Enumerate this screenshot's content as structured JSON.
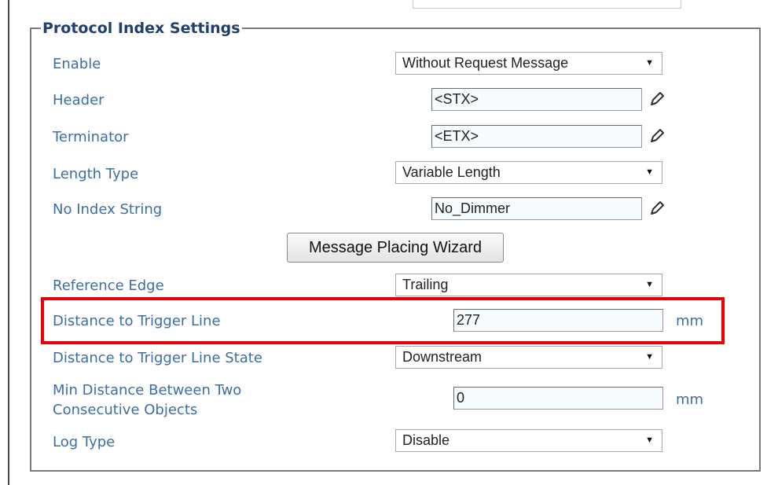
{
  "panel": {
    "title": "Protocol Index Settings"
  },
  "fields": {
    "enable": {
      "label": "Enable",
      "value": "Without Request Message"
    },
    "header": {
      "label": "Header",
      "value": "<STX>"
    },
    "terminator": {
      "label": "Terminator",
      "value": "<ETX>"
    },
    "length_type": {
      "label": "Length Type",
      "value": "Variable Length"
    },
    "no_index_string": {
      "label": "No Index String",
      "value": "No_Dimmer"
    },
    "reference_edge": {
      "label": "Reference Edge",
      "value": "Trailing"
    },
    "distance_to_trigger_line": {
      "label": "Distance to Trigger Line",
      "value": "277",
      "unit": "mm"
    },
    "distance_to_trigger_line_state": {
      "label": "Distance to Trigger Line State",
      "value": "Downstream"
    },
    "min_distance": {
      "label_line1": "Min Distance Between Two",
      "label_line2": "Consecutive Objects",
      "value": "0",
      "unit": "mm"
    },
    "log_type": {
      "label": "Log Type",
      "value": "Disable"
    }
  },
  "buttons": {
    "wizard": "Message Placing Wizard"
  },
  "icons": {
    "edit": "pencil-icon",
    "dropdown": "chevron-down-icon"
  },
  "colors": {
    "label": "#3c6ea5",
    "title": "#1f3f73",
    "highlight": "#e8000b",
    "input_bg": "#f6fbff"
  }
}
